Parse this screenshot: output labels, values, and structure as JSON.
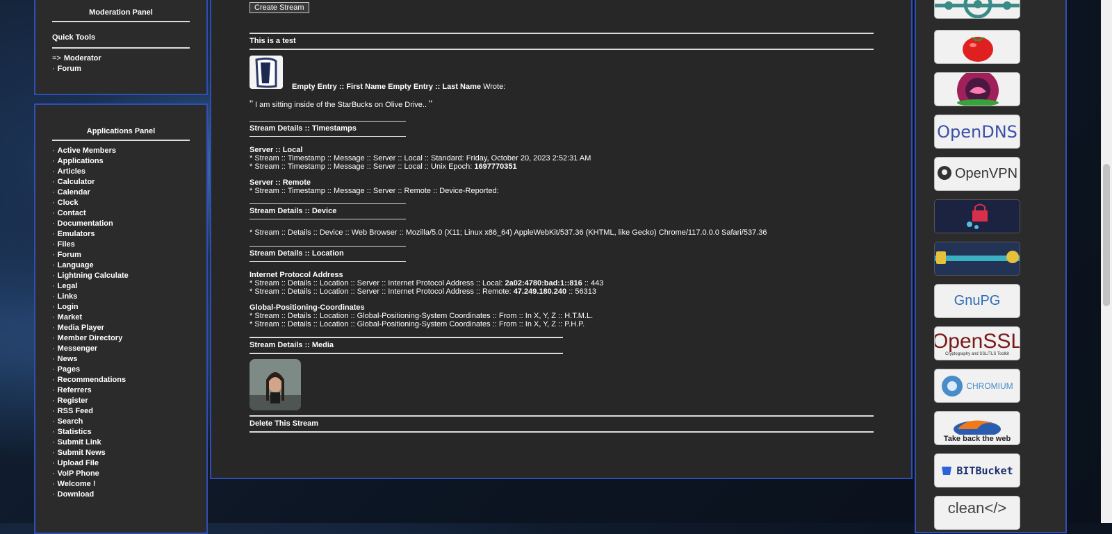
{
  "moderation": {
    "title": "Moderation Panel",
    "quick_tools": "Quick Tools",
    "items": [
      {
        "bullet": "=>",
        "label": "Moderator"
      },
      {
        "bullet": "·",
        "label": "Forum"
      }
    ]
  },
  "applications": {
    "title": "Applications Panel",
    "items": [
      "Active Members",
      "Applications",
      "Articles",
      "Calculator",
      "Calendar",
      "Clock",
      "Contact",
      "Documentation",
      "Emulators",
      "Files",
      "Forum",
      "Language",
      "Lightning Calculate",
      "Legal",
      "Links",
      "Login",
      "Market",
      "Media Player",
      "Member Directory",
      "Messenger",
      "News",
      "Pages",
      "Recommendations",
      "Referrers",
      "Register",
      "RSS Feed",
      "Search",
      "Statistics",
      "Submit Link",
      "Submit News",
      "Upload File",
      "VoIP Phone",
      "Welcome !",
      "Download"
    ]
  },
  "stream": {
    "create_button": "Create Stream",
    "title": "This is a test",
    "author": "Empty Entry :: First Name Empty Entry :: Last Name",
    "wrote": "Wrote:",
    "quote_open": "\"",
    "message": "I am sitting inside of the StarBucks on Olive Drive..",
    "quote_close": "\"",
    "timestamps": {
      "title": "Stream Details :: Timestamps",
      "local_head": "Server :: Local",
      "local_standard": "* Stream :: Timestamp :: Message :: Server :: Local :: Standard: Friday, October 20, 2023 2:52:31 AM",
      "local_epoch_prefix": "* Stream :: Timestamp :: Message :: Server :: Local :: Unix Epoch:",
      "local_epoch_value": "1697770351",
      "remote_head": "Server :: Remote",
      "remote_line": "* Stream :: Timestamp :: Message :: Server :: Remote :: Device-Reported:"
    },
    "device": {
      "title": "Stream Details :: Device",
      "line": "* Stream :: Details :: Device :: Web Browser :: Mozilla/5.0 (X11; Linux x86_64) AppleWebKit/537.36 (KHTML, like Gecko) Chrome/117.0.0.0 Safari/537.36"
    },
    "location": {
      "title": "Stream Details :: Location",
      "ip_head": "Internet Protocol Address",
      "ip_local_prefix": "* Stream :: Details :: Location :: Server :: Internet Protocol Address :: Local:",
      "ip_local_value": "2a02:4780:bad:1::816",
      "ip_local_port": ":: 443",
      "ip_remote_prefix": "* Stream :: Details :: Location :: Server :: Internet Protocol Address :: Remote:",
      "ip_remote_value": "47.249.180.240",
      "ip_remote_port": ":: 56313",
      "gps_head": "Global-Positioning-Coordinates",
      "gps_html": "* Stream :: Details :: Location :: Global-Positioning-System Coordinates :: From :: In X, Y, Z :: H.T.M.L.",
      "gps_php": "* Stream :: Details :: Location :: Global-Positioning-System Coordinates :: From :: In X, Y, Z :: P.H.P."
    },
    "media": {
      "title": "Stream Details :: Media"
    },
    "delete": "Delete This Stream"
  },
  "sidebar_logos": [
    {
      "name": "Lightning network"
    },
    {
      "name": "Tomato"
    },
    {
      "name": "Lotus"
    },
    {
      "name": "OpenDNS",
      "text": "OpenDNS",
      "color": "#3d4fa8"
    },
    {
      "name": "OpenVPN",
      "text": "OpenVPN",
      "color": "#333333"
    },
    {
      "name": "Privacy"
    },
    {
      "name": "Key"
    },
    {
      "name": "GnuPG",
      "text": "GnuPG",
      "color": "#2e6db4"
    },
    {
      "name": "OpenSSL",
      "text": "OpenSSL",
      "subtext": "Cryptography and SSL/TLS Toolkit",
      "color": "#7a1a1a"
    },
    {
      "name": "Chromium",
      "text": "CHROMIUM",
      "color": "#4a8cc9"
    },
    {
      "name": "Firefox",
      "text": "Take back the web",
      "color": "#222222"
    },
    {
      "name": "BitBucket",
      "text": "BITBucket",
      "color": "#1b2f6b"
    },
    {
      "name": "Clean code",
      "text": "clean</>",
      "color": "#444444"
    }
  ],
  "colors": {
    "panel_border": "#2f4fb5",
    "panel_bg": "#2b2b2b",
    "text": "#ffffff"
  }
}
